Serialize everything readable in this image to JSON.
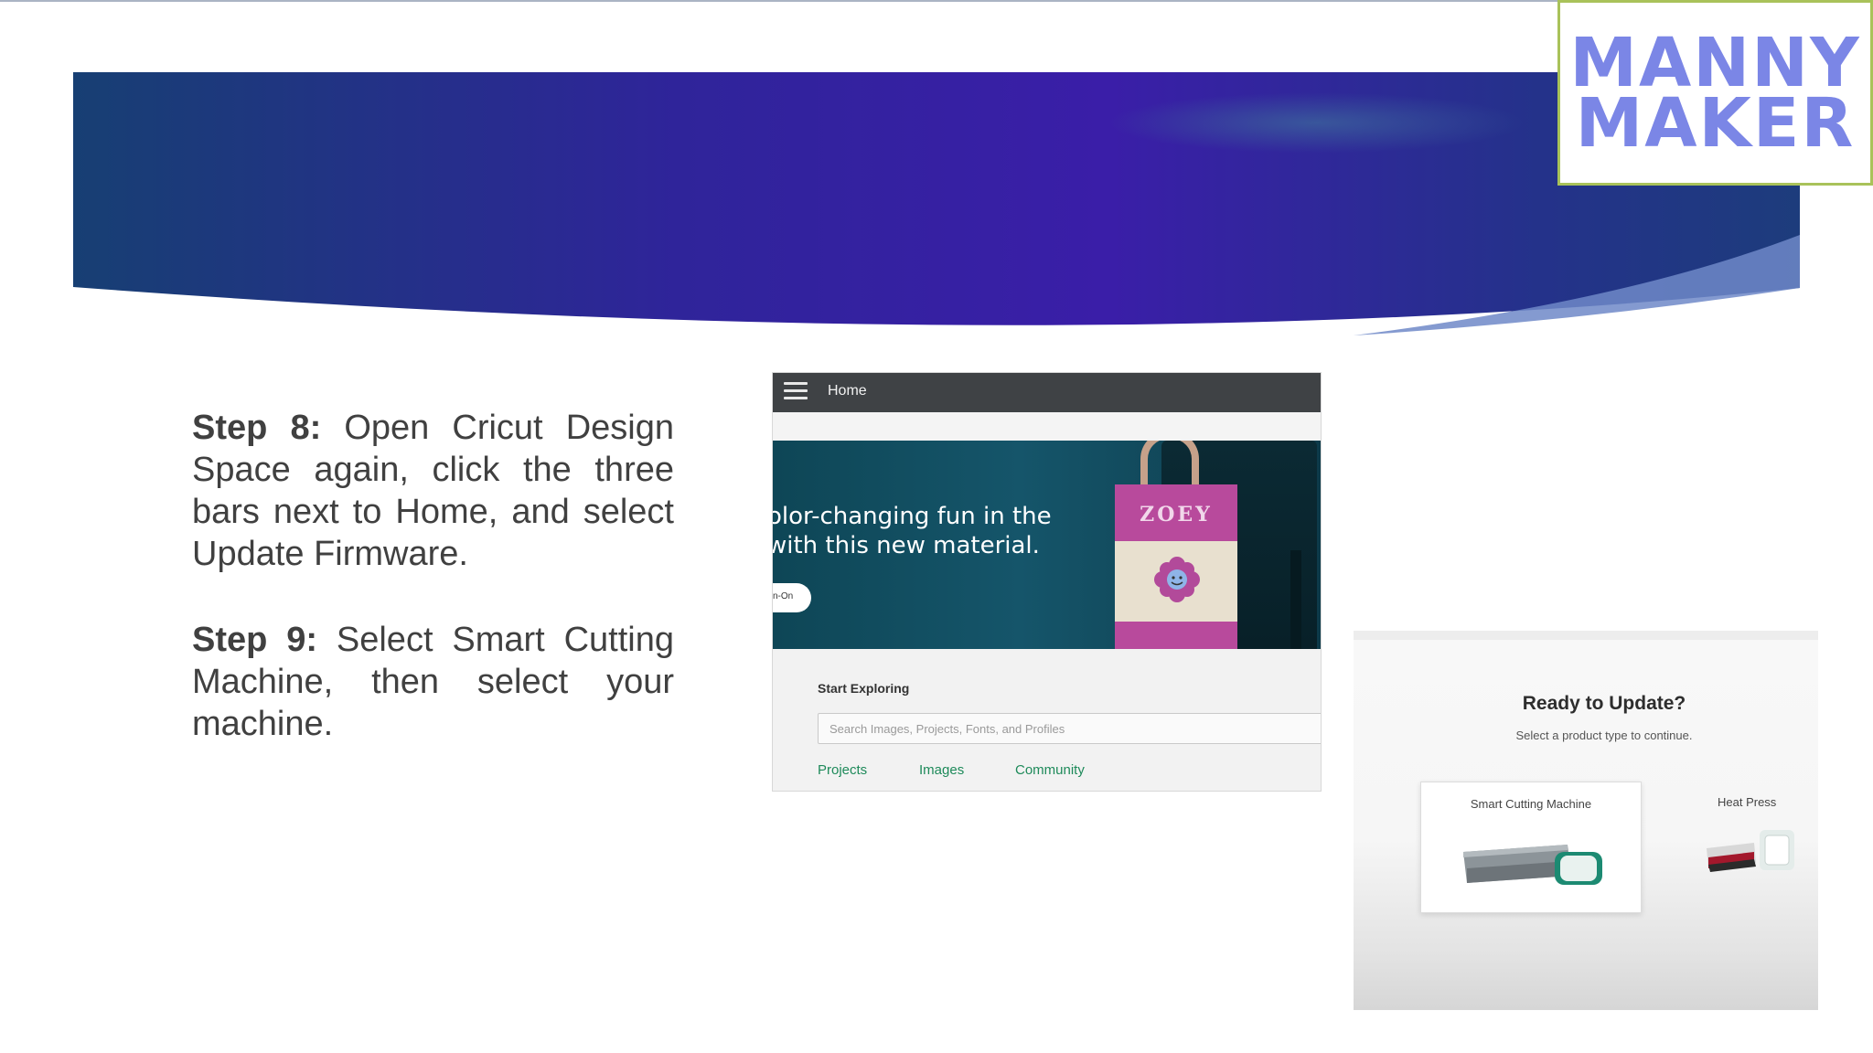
{
  "slide": {
    "steps": [
      {
        "label": "Step 8:",
        "text": " Open Cricut Design Space again, click the three bars next to Home, and select Update Firmware."
      },
      {
        "label": "Step 9:",
        "text": " Select Smart Cutting Machine, then select your machine."
      }
    ]
  },
  "logo": {
    "line1": "MANNY",
    "line2": "MAKER"
  },
  "home_screenshot": {
    "header_title": "Home",
    "hero_line1": "olor-changing fun in the",
    "hero_line2": "with this new material.",
    "hero_button": "n-On",
    "tote_name": "ZOEY",
    "explore_title": "Start Exploring",
    "search_placeholder": "Search Images, Projects, Fonts, and Profiles",
    "links": [
      "Projects",
      "Images",
      "Community"
    ]
  },
  "update_screenshot": {
    "title": "Ready to Update?",
    "subtitle": "Select a product type to continue.",
    "products": [
      "Smart Cutting Machine",
      "Heat Press"
    ]
  },
  "colors": {
    "banner_start": "#1c3a6e",
    "banner_mid": "#3a1ea6",
    "logo_text": "#7b86e6",
    "logo_border": "#a9c25a",
    "link_green": "#1e8a5a"
  }
}
